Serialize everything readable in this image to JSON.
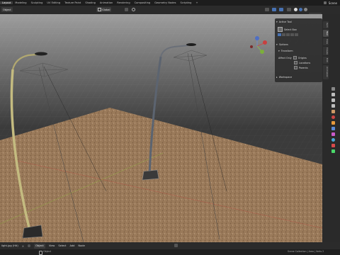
{
  "topbar": {
    "workspaces": [
      "Layout",
      "Modeling",
      "Sculpting",
      "UV Editing",
      "Texture Paint",
      "Shading",
      "Animation",
      "Rendering",
      "Compositing",
      "Geometry Nodes",
      "Scripting"
    ],
    "active_workspace": "Layout",
    "scene": "Scene"
  },
  "header": {
    "mode": "Object",
    "orientation": "Global",
    "options_label": "Options"
  },
  "panel": {
    "active_tool_header": "Active Tool",
    "tool_name": "Select Box",
    "options_header": "Options",
    "transform_header": "Transform",
    "affect_only_label": "Affect Only",
    "affect_only_items": [
      "Origins",
      "Locations",
      "Parents"
    ],
    "workspace_header": "Workspace"
  },
  "side_tabs": [
    "Item",
    "Tool",
    "View",
    "Create",
    "Edit",
    "Animation"
  ],
  "bottombar": {
    "file": "light.jpg (Hit)",
    "mode": "Object",
    "menus": [
      "View",
      "Select",
      "Add",
      "Node"
    ]
  },
  "statusbar": {
    "left": "Object",
    "right": "Scene Collection | Area | Verts 2"
  },
  "colors": {
    "accent": "#4772b3",
    "ground": "#9a7a5a",
    "grid_bg": "#3d3d3d"
  }
}
